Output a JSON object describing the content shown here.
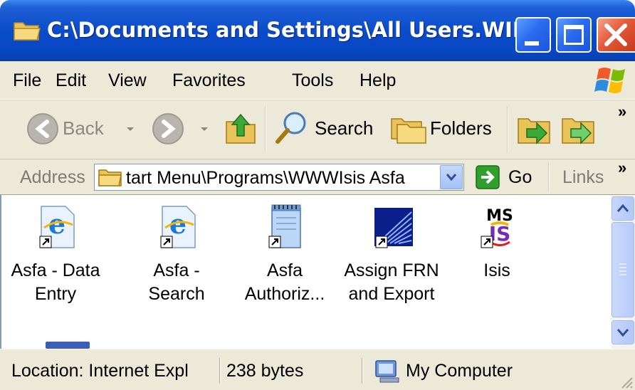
{
  "window": {
    "title": "C:\\Documents and Settings\\All Users.WIN..."
  },
  "menu": {
    "items": [
      "File",
      "Edit",
      "View",
      "Favorites",
      "Tools",
      "Help"
    ]
  },
  "toolbar": {
    "back_label": "Back",
    "search_label": "Search",
    "folders_label": "Folders",
    "chevron": "»"
  },
  "address": {
    "label": "Address",
    "value": "tart Menu\\Programs\\WWWIsis Asfa",
    "go_label": "Go",
    "links_label": "Links",
    "chevron": "»"
  },
  "items": [
    {
      "label_line1": "Asfa - Data",
      "label_line2": "Entry",
      "icon": "ie-shortcut-icon"
    },
    {
      "label_line1": "Asfa -",
      "label_line2": "Search",
      "icon": "ie-shortcut-icon"
    },
    {
      "label_line1": "Asfa",
      "label_line2": "Authoriz...",
      "icon": "notepad-shortcut-icon"
    },
    {
      "label_line1": "Assign FRN",
      "label_line2": "and Export",
      "icon": "app-shortcut-icon"
    },
    {
      "label_line1": "Isis",
      "label_line2": "",
      "icon": "ms-isis-shortcut-icon"
    }
  ],
  "status": {
    "location": "Location: Internet Expl",
    "size": "238 bytes",
    "zone": "My Computer"
  },
  "colors": {
    "title_blue": "#0a4ccb",
    "chrome_beige": "#ece9d8",
    "close_red": "#e45a3a"
  }
}
